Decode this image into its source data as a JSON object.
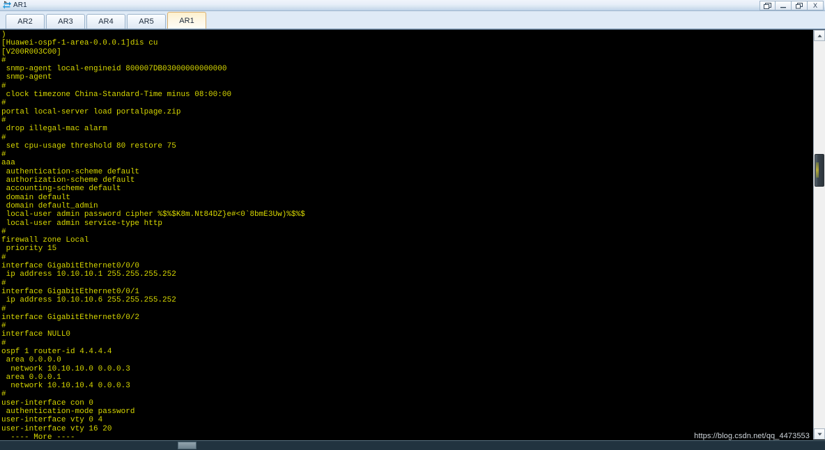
{
  "window": {
    "title": "AR1",
    "icon": "router-icon",
    "buttons": [
      {
        "name": "restore-button",
        "glyph": "❐"
      },
      {
        "name": "minimize-button",
        "glyph": "—"
      },
      {
        "name": "maximize-button",
        "glyph": "❐"
      },
      {
        "name": "close-button",
        "glyph": "X"
      }
    ]
  },
  "tabs": [
    {
      "label": "AR2",
      "active": false
    },
    {
      "label": "AR3",
      "active": false
    },
    {
      "label": "AR4",
      "active": false
    },
    {
      "label": "AR5",
      "active": false
    },
    {
      "label": "AR1",
      "active": true
    }
  ],
  "terminal": {
    "foreground": "#d8d800",
    "background": "#000000",
    "lines": [
      ")",
      "[Huawei-ospf-1-area-0.0.0.1]dis cu",
      "[V200R003C00]",
      "#",
      " snmp-agent local-engineid 800007DB03000000000000",
      " snmp-agent",
      "#",
      " clock timezone China-Standard-Time minus 08:00:00",
      "#",
      "portal local-server load portalpage.zip",
      "#",
      " drop illegal-mac alarm",
      "#",
      " set cpu-usage threshold 80 restore 75",
      "#",
      "aaa",
      " authentication-scheme default",
      " authorization-scheme default",
      " accounting-scheme default",
      " domain default",
      " domain default_admin",
      " local-user admin password cipher %$%$K8m.Nt84DZ}e#<0`8bmE3Uw)%$%$",
      " local-user admin service-type http",
      "#",
      "firewall zone Local",
      " priority 15",
      "#",
      "interface GigabitEthernet0/0/0",
      " ip address 10.10.10.1 255.255.255.252",
      "#",
      "interface GigabitEthernet0/0/1",
      " ip address 10.10.10.6 255.255.255.252",
      "#",
      "interface GigabitEthernet0/0/2",
      "#",
      "interface NULL0",
      "#",
      "ospf 1 router-id 4.4.4.4",
      " area 0.0.0.0",
      "  network 10.10.10.0 0.0.0.3",
      " area 0.0.0.1",
      "  network 10.10.10.4 0.0.0.3",
      "#",
      "user-interface con 0",
      " authentication-mode password",
      "user-interface vty 0 4",
      "user-interface vty 16 20",
      "  ---- More ----"
    ]
  },
  "scrollbars": {
    "vertical": {
      "up_glyph": "▲",
      "down_glyph": "▼"
    },
    "horizontal": {}
  },
  "watermark": {
    "text": "https://blog.csdn.net/qq_4473553"
  }
}
